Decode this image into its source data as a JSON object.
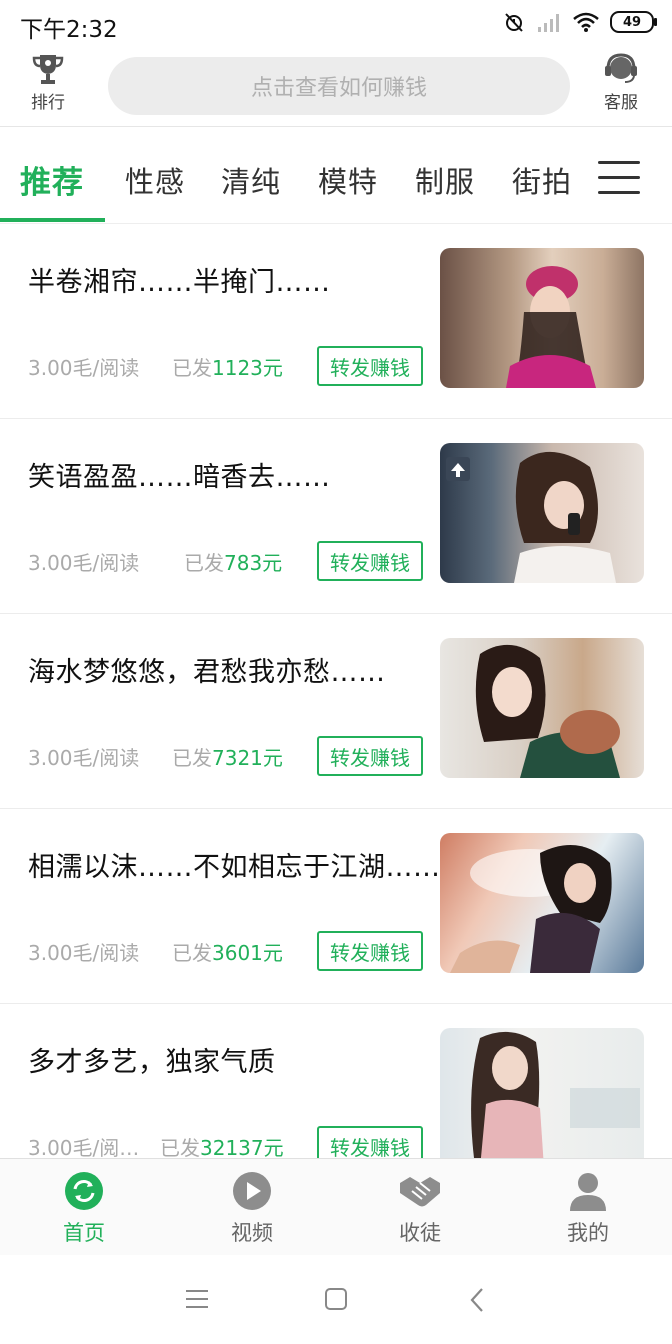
{
  "status": {
    "time": "下午2:32",
    "battery": "49"
  },
  "topbar": {
    "rank_label": "排行",
    "search_placeholder": "点击查看如何赚钱",
    "service_label": "客服"
  },
  "tabs": [
    {
      "label": "推荐",
      "active": true
    },
    {
      "label": "性感"
    },
    {
      "label": "清纯"
    },
    {
      "label": "模特"
    },
    {
      "label": "制服"
    },
    {
      "label": "街拍"
    }
  ],
  "articles": [
    {
      "title": "半卷湘帘……半掩门……",
      "price": "3.00毛/阅读",
      "sent_prefix": "已发",
      "sent_amount": "1123元",
      "share_label": "转发赚钱"
    },
    {
      "title": "笑语盈盈……暗香去……",
      "price": "3.00毛/阅读",
      "sent_prefix": "已发",
      "sent_amount": "783元",
      "share_label": "转发赚钱"
    },
    {
      "title": "海水梦悠悠，君愁我亦愁……",
      "price": "3.00毛/阅读",
      "sent_prefix": "已发",
      "sent_amount": "7321元",
      "share_label": "转发赚钱"
    },
    {
      "title": "相濡以沫……不如相忘于江湖……",
      "price": "3.00毛/阅读",
      "sent_prefix": "已发",
      "sent_amount": "3601元",
      "share_label": "转发赚钱"
    },
    {
      "title": "多才多艺，独家气质",
      "price": "3.00毛/阅…",
      "sent_prefix": "已发",
      "sent_amount": "32137元",
      "share_label": "转发赚钱"
    }
  ],
  "bottom_nav": [
    {
      "label": "首页",
      "icon": "home-refresh-icon",
      "active": true
    },
    {
      "label": "视频",
      "icon": "play-icon"
    },
    {
      "label": "收徒",
      "icon": "handshake-icon"
    },
    {
      "label": "我的",
      "icon": "user-icon"
    }
  ],
  "colors": {
    "accent": "#21b05a"
  }
}
